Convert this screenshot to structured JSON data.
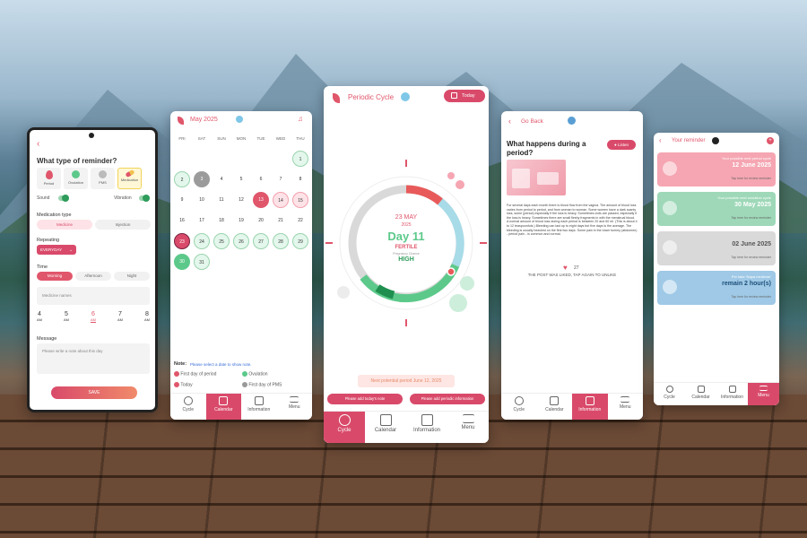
{
  "p1": {
    "title": "What type of reminder?",
    "types": [
      "Period",
      "Ovulation",
      "PMS",
      "Medication"
    ],
    "sound": "Sound",
    "vibration": "Vibration",
    "medtype_label": "Medication type",
    "medtypes": [
      "Medicine",
      "Injection"
    ],
    "repeat_label": "Repeating",
    "repeat_value": "EVERYDAY",
    "time_label": "Time",
    "times": [
      "Morning",
      "Afternoon",
      "Night"
    ],
    "medicine_placeholder": "Medicine names",
    "hours": [
      {
        "h": "4",
        "ap": "AM"
      },
      {
        "h": "5",
        "ap": "AM"
      },
      {
        "h": "6",
        "ap": "AM"
      },
      {
        "h": "7",
        "ap": "AM"
      },
      {
        "h": "8",
        "ap": "AM"
      }
    ],
    "message_label": "Message",
    "message_placeholder": "Please write a note about this day",
    "save": "SAVE"
  },
  "p2": {
    "month": "May 2025",
    "days": [
      "FRI",
      "SAT",
      "SUN",
      "MON",
      "TUE",
      "WED",
      "THU"
    ],
    "note_label": "Note:",
    "note_hint": "Please select a date to show note.",
    "legend": [
      "First day of period",
      "Ovulation",
      "Today",
      "First day of PMS"
    ],
    "nav": [
      "Cycle",
      "Calendar",
      "Information",
      "Menu"
    ]
  },
  "p3": {
    "title": "Periodic Cycle",
    "today_btn": "Today",
    "date": "23 MAY",
    "year": "2025",
    "day": "Day 11",
    "fertile": "FERTILE",
    "pregnancy": "Pregnancy Chance",
    "high": "HIGH",
    "next_period": "Next potential period June 12, 2025",
    "btn_note": "Please add today's note",
    "btn_info": "Please add periodic information",
    "nav": [
      "Cycle",
      "Calendar",
      "Information",
      "Menu"
    ]
  },
  "p4": {
    "back": "Go Back",
    "headline": "What happens during a period?",
    "listen": "Listen",
    "body": "For several days each month there is blood flow from the vagina. The amount of blood loss varies from period to period, and from woman to woman. Some women have a dark scanty loss, some (period) especially if the loss is heavy. Sometimes clots are passed, especially if the loss is heavy. Sometimes there are small fleshy fragments in with the menstrual blood. A normal amount of blood loss during each period is between 20 and 60 ml. (This is about 4 to 12 teaspoonfuls.) Bleeding can last up to eight days but five days is the average. The bleeding is usually heaviest on the first two days. Some pain in the lower tummy (abdomen) - period pain - is common and normal.",
    "likes": "27",
    "liked_msg": "THE POST WAS LIKED, TAP AGAIN TO UNLIKE",
    "nav": [
      "Cycle",
      "Calendar",
      "Information",
      "Menu"
    ]
  },
  "p5": {
    "title": "Your reminder",
    "cards": [
      {
        "label": "Your possible next period cycle",
        "value": "12 June 2025",
        "hint": "Tap here for review reminder",
        "color": "#f5a6b2"
      },
      {
        "label": "Your possible next ovulation cycle",
        "value": "30 May 2025",
        "hint": "Tap here for review reminder",
        "color": "#9ed8b8"
      },
      {
        "label": "",
        "value": "02 June 2025",
        "hint": "Tap here for review reminder",
        "color": "#d9d9d9"
      },
      {
        "label": "Per take 'Napa medicine'",
        "value": "remain 2 hour(s)",
        "hint": "Tap here for review reminder",
        "color": "#9fc9e6"
      }
    ],
    "nav": [
      "Cycle",
      "Calendar",
      "Information",
      "Menu"
    ]
  },
  "colors": {
    "accent": "#e0566b",
    "green": "#5cc98a",
    "grey": "#cfcfcf",
    "blue": "#a8dbe8"
  }
}
